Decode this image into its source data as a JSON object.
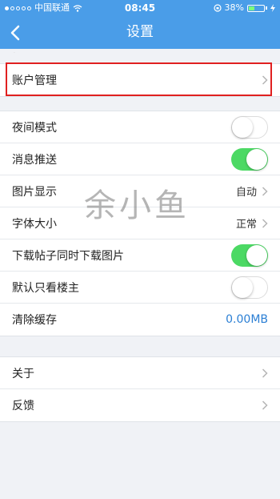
{
  "status_bar": {
    "carrier": "中国联通",
    "time": "08:45",
    "battery": "38%",
    "battery_level": 0.38
  },
  "nav": {
    "title": "设置"
  },
  "groups": {
    "account": {
      "rows": [
        {
          "label": "账户管理"
        }
      ]
    },
    "main": {
      "rows": [
        {
          "label": "夜间模式",
          "toggle": false
        },
        {
          "label": "消息推送",
          "toggle": true
        },
        {
          "label": "图片显示",
          "value": "自动"
        },
        {
          "label": "字体大小",
          "value": "正常"
        },
        {
          "label": "下载帖子同时下载图片",
          "toggle": true
        },
        {
          "label": "默认只看楼主",
          "toggle": false
        },
        {
          "label": "清除缓存",
          "value": "0.00MB"
        }
      ]
    },
    "misc": {
      "rows": [
        {
          "label": "关于"
        },
        {
          "label": "反馈"
        }
      ]
    }
  },
  "watermark": "余小鱼",
  "colors": {
    "nav_bg": "#4a9de8",
    "toggle_on": "#4cd964",
    "highlight": "#e02020",
    "value_blue": "#2b7fd4"
  }
}
